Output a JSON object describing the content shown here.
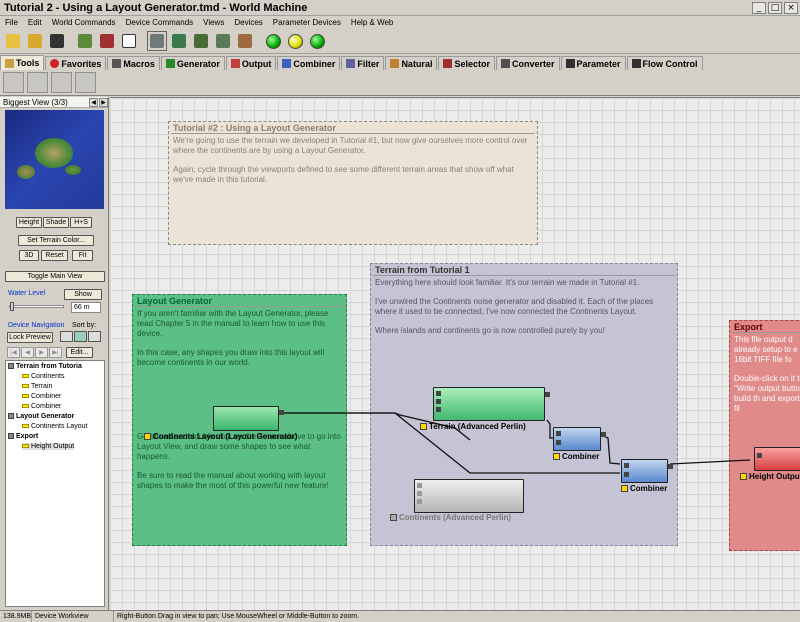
{
  "window": {
    "title": "Tutorial 2 - Using a Layout Generator.tmd - World Machine"
  },
  "menu": [
    "File",
    "Edit",
    "World Commands",
    "Device Commands",
    "Views",
    "Devices",
    "Parameter Devices",
    "Help & Web"
  ],
  "tabs": [
    "Tools",
    "Favorites",
    "Macros",
    "Generator",
    "Output",
    "Combiner",
    "Filter",
    "Natural",
    "Selector",
    "Converter",
    "Parameter",
    "Flow Control"
  ],
  "left_panel": {
    "view_title": "Biggest View (3/3)",
    "buttons": {
      "height": "Height",
      "shade": "Shade",
      "hs": "H+S",
      "set_color": "Set Terrain Color...",
      "three_d": "3D",
      "reset": "Reset",
      "fit": "Fit",
      "toggle": "Toggle Main View",
      "show": "Show",
      "lock": "Lock Preview",
      "edit": "Edit..."
    },
    "water_level_label": "Water Level",
    "water_value": "66 m",
    "device_nav": "Device Navigation",
    "sort_by": "Sort by:",
    "tree": [
      {
        "label": "Terrain from Tutoria",
        "level": 0
      },
      {
        "label": "Continents",
        "level": 1
      },
      {
        "label": "Terrain",
        "level": 1
      },
      {
        "label": "Combiner",
        "level": 1
      },
      {
        "label": "Combiner",
        "level": 1
      },
      {
        "label": "Layout Generator",
        "level": 0
      },
      {
        "label": "Continents Layout",
        "level": 1
      },
      {
        "label": "Export",
        "level": 0
      },
      {
        "label": "Height Output",
        "level": 1
      }
    ]
  },
  "groups": {
    "tutorial": {
      "title": "Tutorial #2 : Using a Layout Generator",
      "p1": "We're going to use the terrain we developed in Tutorial #1, but now give ourselves more control over where the continents are by using a Layout Generator.",
      "p2": "Again, cycle through the viewports defined to see some different terrain areas that show off what we've made in this tutorial."
    },
    "layout": {
      "title": "Layout Generator",
      "p1": "If you aren't familiar with the Layout Generator, please read Chapter 5 in the manual to learn how to use this device.",
      "p2": "In this case, any shapes you draw into this layout will become continents in our world.",
      "p3": "Go ahead and double click on the device above to go into Layout View, and draw some shapes to see what happens.",
      "p4": "Be sure to read the manual about working with layout shapes to make the most of this powerful new feature!"
    },
    "terrain": {
      "title": "Terrain from Tutorial 1",
      "p1": "Everything here should look familiar. It's our terrain we made in Tutorial #1.",
      "p2": "I've unwired the Continents noise generator and disabled it. Each of the places where it used to be connected, I've now connected the Continents Layout.",
      "p3": "Where islands and continents go is now controlled purely by you!"
    },
    "export": {
      "title": "Export",
      "p1": "This file output d already setup to e 16bit TIFF file fo",
      "p2": "Double-click on it the \"Write output button to build th and export the fil"
    }
  },
  "nodes": {
    "continents_layout": "Continents Layout (Layout Generator)",
    "terrain": "Terrain (Advanced Perlin)",
    "combiner1": "Combiner",
    "combiner2": "Combiner",
    "continents": "Continents (Advanced Perlin)",
    "height_output": "Height Output"
  },
  "status": {
    "memory": "138.9MB",
    "mode": "Device Workview",
    "hint": "Right-Button Drag in view to pan; Use MouseWheel or Middle-Button to zoom."
  }
}
